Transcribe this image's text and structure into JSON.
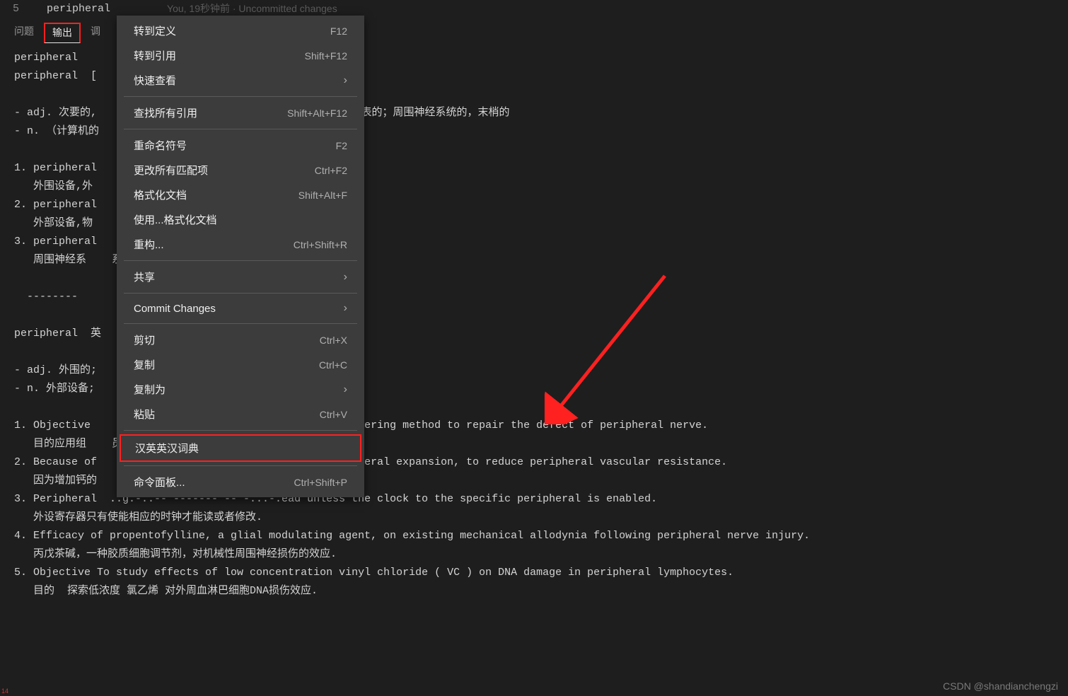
{
  "editor": {
    "line_number": "5",
    "code": "peripheral",
    "gitlens": "You, 19秒钟前 · Uncommitted changes"
  },
  "tabs": {
    "problems": "问题",
    "output": "输出",
    "debug": "调"
  },
  "output_lines": [
    "peripheral",
    "peripheral  [",
    "",
    "- adj. 次要的,                            )外围的；（剖）体表的；周围神经系统的，末梢的",
    "- n. （计算机的",
    "",
    "1. peripheral ",
    "   外围设备,外",
    "2. peripheral ",
    "   外部设备,物",
    "3. peripheral ",
    "   周围神经系    系统",
    "",
    "  --------",
    "",
    "peripheral  英                             ~  iciba.com",
    "",
    "- adj. 外围的;",
    "- n. 外部设备;",
    "",
    "1. Objective                               issue engineering method to repair the defect of peripheral nerve.",
    "   目的应用组    员.",
    "2. Because of                               make peripheral expansion, to reduce peripheral vascular resistance.",
    "   因为增加钙的                            外周血管阻力.",
    "3. Peripheral  ..g.-..-- ------- -- -...-.ead unless the clock to the specific peripheral is enabled.",
    "   外设寄存器只有使能相应的时钟才能读或者修改.",
    "4. Efficacy of propentofylline, a glial modulating agent, on existing mechanical allodynia following peripheral nerve injury.",
    "   丙戊茶碱，一种胶质细胞调节剂，对机械性周围神经损伤的效应.",
    "5. Objective To study effects of low concentration vinyl chloride ( VC ) on DNA damage in peripheral lymphocytes.",
    "   目的  探索低浓度 氯乙烯 对外周血淋巴细胞DNA损伤效应."
  ],
  "menu": {
    "groups": [
      [
        {
          "label": "转到定义",
          "shortcut": "F12",
          "submenu": false
        },
        {
          "label": "转到引用",
          "shortcut": "Shift+F12",
          "submenu": false
        },
        {
          "label": "快速查看",
          "shortcut": "",
          "submenu": true
        }
      ],
      [
        {
          "label": "查找所有引用",
          "shortcut": "Shift+Alt+F12",
          "submenu": false
        }
      ],
      [
        {
          "label": "重命名符号",
          "shortcut": "F2",
          "submenu": false
        },
        {
          "label": "更改所有匹配项",
          "shortcut": "Ctrl+F2",
          "submenu": false
        },
        {
          "label": "格式化文档",
          "shortcut": "Shift+Alt+F",
          "submenu": false
        },
        {
          "label": "使用...格式化文档",
          "shortcut": "",
          "submenu": false
        },
        {
          "label": "重构...",
          "shortcut": "Ctrl+Shift+R",
          "submenu": false
        }
      ],
      [
        {
          "label": "共享",
          "shortcut": "",
          "submenu": true
        }
      ],
      [
        {
          "label": "Commit Changes",
          "shortcut": "",
          "submenu": true
        }
      ],
      [
        {
          "label": "剪切",
          "shortcut": "Ctrl+X",
          "submenu": false
        },
        {
          "label": "复制",
          "shortcut": "Ctrl+C",
          "submenu": false
        },
        {
          "label": "复制为",
          "shortcut": "",
          "submenu": true
        },
        {
          "label": "粘贴",
          "shortcut": "Ctrl+V",
          "submenu": false
        }
      ],
      [
        {
          "label": "汉英英汉词典",
          "shortcut": "",
          "submenu": false,
          "highlight": true
        }
      ],
      [
        {
          "label": "命令面板...",
          "shortcut": "Ctrl+Shift+P",
          "submenu": false
        }
      ]
    ]
  },
  "watermark": "CSDN @shandianchengzi",
  "corner": "14"
}
